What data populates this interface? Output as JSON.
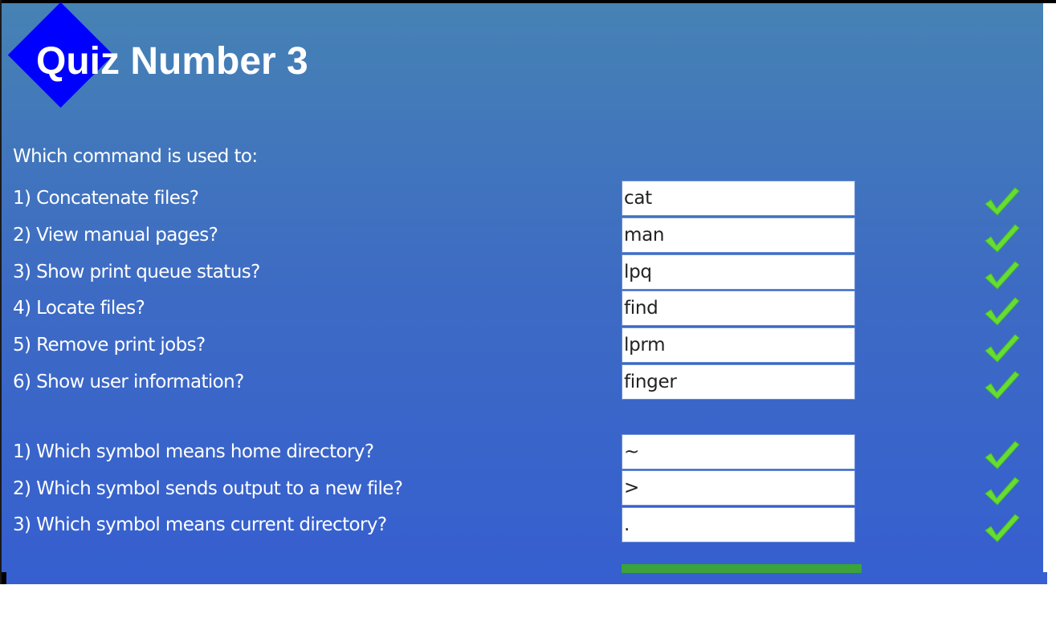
{
  "title": "Quiz Number 3",
  "intro": "Which command is used to:",
  "colors": {
    "panel_top": "#4682b4",
    "panel_bottom": "#365fcf",
    "diamond": "#0000ff",
    "check": "#66dd33",
    "submit_bar": "#3aa33a"
  },
  "commands": [
    {
      "question": "1) Concatenate files?",
      "answer": "cat",
      "status": "correct"
    },
    {
      "question": "2) View manual pages?",
      "answer": "man",
      "status": "correct"
    },
    {
      "question": "3) Show print queue status?",
      "answer": "lpq",
      "status": "correct"
    },
    {
      "question": "4) Locate files?",
      "answer": "find",
      "status": "correct"
    },
    {
      "question": "5) Remove print jobs?",
      "answer": "lprm",
      "status": "correct"
    },
    {
      "question": "6) Show user information?",
      "answer": "finger",
      "status": "correct"
    }
  ],
  "symbols": [
    {
      "question": "1) Which symbol means home directory?",
      "answer": "~",
      "status": "correct"
    },
    {
      "question": "2) Which symbol sends output to a new file?",
      "answer": ">",
      "status": "correct"
    },
    {
      "question": "3) Which symbol means current directory?",
      "answer": ".",
      "status": "correct"
    }
  ],
  "icons": {
    "check": "checkmark-icon",
    "logo": "diamond-logo-icon"
  }
}
